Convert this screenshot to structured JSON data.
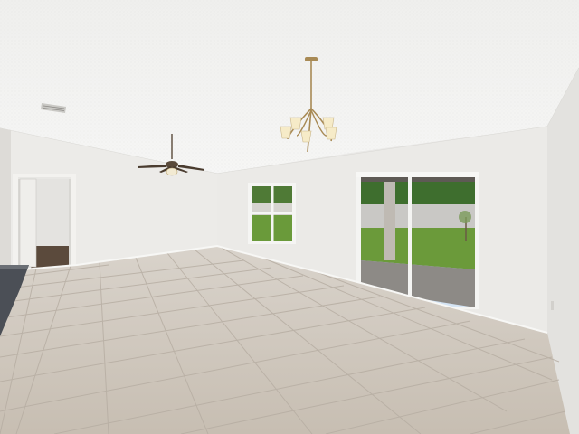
{
  "scene": {
    "description_free": true,
    "colors": {
      "ceiling": "#f1f1ef",
      "wall": "#ecebe9",
      "wall_shadow": "#dedcd9",
      "floor": "#cfc7bd",
      "grout": "#b8afa4",
      "lawn": "#6f9b3c",
      "sky": "#9fc2ea",
      "water": "#c9c8c5",
      "trees": "#3d6a2b",
      "counter": "#4a4e55",
      "fixture_metal": "#a88a55",
      "shade": "#f6ebc8"
    },
    "icons": [
      "chandelier-icon",
      "ceiling-fan-icon",
      "air-vent-icon"
    ]
  }
}
